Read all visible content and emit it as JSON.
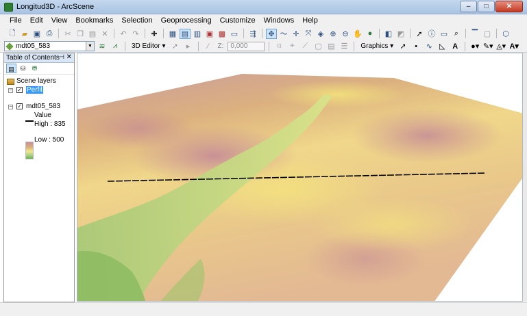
{
  "window": {
    "title": "Longitud3D - ArcScene",
    "minimize": "–",
    "maximize": "□",
    "close": "✕"
  },
  "menu": [
    "File",
    "Edit",
    "View",
    "Bookmarks",
    "Selection",
    "Geoprocessing",
    "Customize",
    "Windows",
    "Help"
  ],
  "toolbar2": {
    "layer_value": "mdt05_583",
    "editor_label": "3D Editor",
    "z_label": "Z:",
    "z_value": "0,000",
    "graphics_label": "Graphics"
  },
  "toc": {
    "title": "Table of Contents",
    "pin": "⊣",
    "close": "✕",
    "group_label": "Scene layers",
    "layers": [
      {
        "name": "Perfil",
        "checked": true,
        "selected": true
      },
      {
        "name": "mdt05_583",
        "checked": true,
        "selected": false
      }
    ],
    "legend": {
      "field": "Value",
      "high_label": "High : 835",
      "low_label": "Low : 500"
    }
  },
  "colors": {
    "elev_low": "#8cbb62",
    "elev_mid": "#f2e07a",
    "elev_high": "#c9909a",
    "profile_line": "#000000",
    "selection": "#3399ff"
  },
  "icons": [
    "new-doc-icon",
    "open-icon",
    "save-icon",
    "print-icon",
    "cut-icon",
    "copy-icon",
    "paste-icon",
    "delete-icon",
    "undo-icon",
    "redo-icon",
    "add-data-icon",
    "navigate-icon",
    "fly-icon",
    "zoom-in-icon",
    "zoom-out-icon",
    "pan-icon",
    "full-extent-icon",
    "select-icon",
    "identify-icon",
    "find-icon",
    "editor-toolbar-icon"
  ]
}
